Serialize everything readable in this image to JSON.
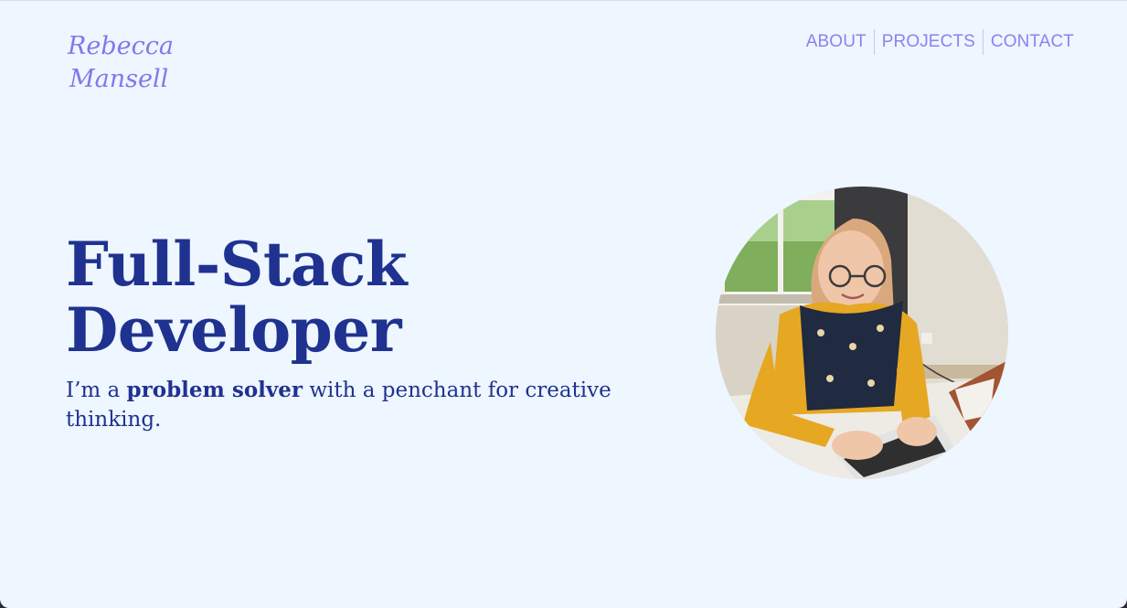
{
  "logo": {
    "line1": "Rebecca",
    "line2": "Mansell",
    "color": "#7f79ea"
  },
  "nav": {
    "items": [
      {
        "label": "ABOUT"
      },
      {
        "label": "PROJECTS"
      },
      {
        "label": "CONTACT"
      }
    ],
    "color": "#8a83f0"
  },
  "hero": {
    "title_line1": "Full-Stack",
    "title_line2": "Developer",
    "subtitle_pre": "I’m a ",
    "subtitle_bold": "problem solver",
    "subtitle_post": " with a penchant for creative thinking.",
    "text_color": "#1f3290"
  },
  "colors": {
    "background": "#eef6ff"
  }
}
